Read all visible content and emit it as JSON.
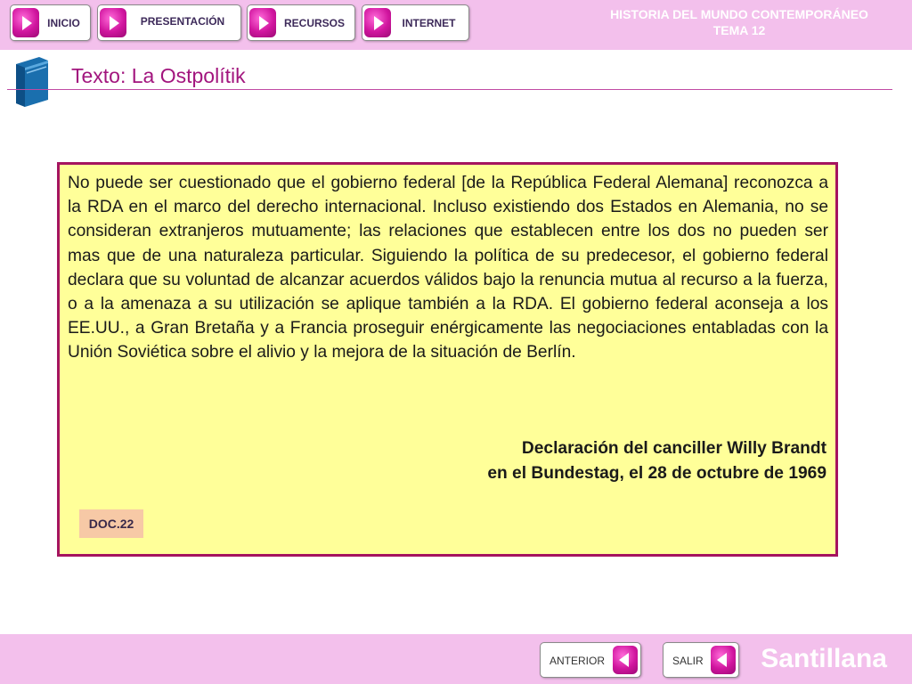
{
  "header": {
    "nav": [
      {
        "label": "INICIO",
        "icon": "play-arrow-icon"
      },
      {
        "label": "PRESENTACIÓN",
        "icon": "play-arrow-icon"
      },
      {
        "label": "RECURSOS",
        "icon": "play-arrow-icon"
      },
      {
        "label": "INTERNET",
        "icon": "play-arrow-icon"
      }
    ],
    "title_line1": "HISTORIA DEL MUNDO CONTEMPORÁNEO",
    "title_line2": "TEMA 12"
  },
  "section": {
    "icon": "book-icon",
    "title": "Texto: La Ostpolítik"
  },
  "document": {
    "body": "No puede ser cuestionado que el gobierno federal [de la República Federal Alemana] reconozca a la RDA en el marco del derecho internacional. Incluso existiendo dos Estados en Alemania, no se consideran extranjeros mutuamente; las relaciones que establecen entre los dos no pueden ser mas que de una naturaleza particular. Siguiendo la política de su predecesor, el gobierno federal declara que su voluntad de alcanzar acuerdos válidos bajo la renuncia mutua al recurso a la fuerza, o a la amenaza a su utilización se aplique también a la RDA. El gobierno federal aconseja a los EE.UU., a Gran Bretaña y a Francia proseguir enérgicamente las negociaciones entabladas con la Unión Soviética sobre el alivio y la mejora de la situación de Berlín.",
    "source_line1": "Declaración del canciller Willy Brandt",
    "source_line2": "en el Bundestag, el 28 de octubre de 1969",
    "badge": "DOC.22"
  },
  "footer": {
    "back_label": "ANTERIOR",
    "exit_label": "SALIR",
    "back_icon": "back-arrow-icon",
    "brand": "Santillana"
  },
  "colors": {
    "bar": "#f3c0ec",
    "accent": "#a2157e",
    "panel": "#ffff99",
    "panel_border": "#a5145f",
    "badge": "#f7c9a6"
  }
}
